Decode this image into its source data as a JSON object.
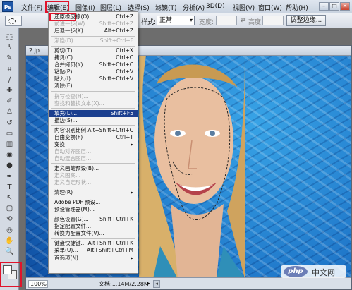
{
  "app": {
    "logo": "Ps"
  },
  "menubar": {
    "items": [
      "文件(F)",
      "编辑(E)",
      "图像(I)",
      "图层(L)",
      "选择(S)",
      "滤镜(T)",
      "分析(A)",
      "3D(D)",
      "视图(V)",
      "窗口(W)",
      "帮助(H)"
    ],
    "window_controls": [
      "–",
      "□",
      "✕"
    ]
  },
  "options_bar": {
    "style_label": "样式:",
    "style_value": "正常",
    "width_label": "宽度:",
    "height_label": "高度:",
    "swap_icon": "⇄",
    "refine_edge_label": "调整边缘..."
  },
  "toolbox": {
    "tools": [
      "marquee-icon",
      "lasso-icon",
      "quick-select-icon",
      "crop-icon",
      "eyedropper-icon",
      "healing-brush-icon",
      "brush-icon",
      "clone-stamp-icon",
      "history-brush-icon",
      "eraser-icon",
      "gradient-icon",
      "blur-icon",
      "dodge-icon",
      "pen-icon",
      "type-icon",
      "path-select-icon",
      "shape-icon",
      "3d-rotate-icon",
      "3d-orbit-icon",
      "hand-icon",
      "zoom-icon"
    ],
    "tool_glyphs": [
      "⬚",
      "ʖ",
      "✎",
      "⌗",
      "∕",
      "✚",
      "✐",
      "♙",
      "↺",
      "▭",
      "▥",
      "◉",
      "●",
      "✒",
      "T",
      "↖",
      "▢",
      "⟲",
      "◎",
      "✋",
      "🔍"
    ]
  },
  "document": {
    "title": "2.jp",
    "zoom": "100%",
    "doc_size": "文档:1.14M/2.28M",
    "status_arrow": "▸",
    "scroll_left": "◂"
  },
  "edit_menu": {
    "items": [
      {
        "label": "还原橡皮擦(O)",
        "shortcut": "Ctrl+Z",
        "disabled": false
      },
      {
        "label": "前进一步(W)",
        "shortcut": "Shift+Ctrl+Z",
        "disabled": true
      },
      {
        "label": "后退一步(K)",
        "shortcut": "Alt+Ctrl+Z",
        "disabled": false
      },
      {
        "sep": true
      },
      {
        "label": "渐隐(D)...",
        "shortcut": "Shift+Ctrl+F",
        "disabled": true
      },
      {
        "sep": true
      },
      {
        "label": "剪切(T)",
        "shortcut": "Ctrl+X",
        "disabled": false
      },
      {
        "label": "拷贝(C)",
        "shortcut": "Ctrl+C",
        "disabled": false
      },
      {
        "label": "合并拷贝(Y)",
        "shortcut": "Shift+Ctrl+C",
        "disabled": false
      },
      {
        "label": "粘贴(P)",
        "shortcut": "Ctrl+V",
        "disabled": false
      },
      {
        "label": "贴入(I)",
        "shortcut": "Shift+Ctrl+V",
        "disabled": false
      },
      {
        "label": "清除(E)",
        "shortcut": "",
        "disabled": false
      },
      {
        "sep": true
      },
      {
        "label": "拼写检查(H)...",
        "shortcut": "",
        "disabled": true
      },
      {
        "label": "查找和替换文本(X)...",
        "shortcut": "",
        "disabled": true
      },
      {
        "sep": true
      },
      {
        "label": "填充(L)...",
        "shortcut": "Shift+F5",
        "disabled": false,
        "highlighted": true
      },
      {
        "label": "描边(S)...",
        "shortcut": "",
        "disabled": false
      },
      {
        "sep": true
      },
      {
        "label": "内容识别比例",
        "shortcut": "Alt+Shift+Ctrl+C",
        "disabled": false
      },
      {
        "label": "自由变换(F)",
        "shortcut": "Ctrl+T",
        "disabled": false
      },
      {
        "label": "变换",
        "shortcut": "▸",
        "disabled": false
      },
      {
        "label": "自动对齐图层...",
        "shortcut": "",
        "disabled": true
      },
      {
        "label": "自动混合图层...",
        "shortcut": "",
        "disabled": true
      },
      {
        "sep": true
      },
      {
        "label": "定义画笔预设(B)...",
        "shortcut": "",
        "disabled": false
      },
      {
        "label": "定义图案...",
        "shortcut": "",
        "disabled": true
      },
      {
        "label": "定义自定形状...",
        "shortcut": "",
        "disabled": true
      },
      {
        "sep": true
      },
      {
        "label": "清理(R)",
        "shortcut": "▸",
        "disabled": false
      },
      {
        "sep": true
      },
      {
        "label": "Adobe PDF 预设...",
        "shortcut": "",
        "disabled": false
      },
      {
        "label": "预设管理器(M)...",
        "shortcut": "",
        "disabled": false
      },
      {
        "sep": true
      },
      {
        "label": "颜色设置(G)...",
        "shortcut": "Shift+Ctrl+K",
        "disabled": false
      },
      {
        "label": "指定配置文件...",
        "shortcut": "",
        "disabled": false
      },
      {
        "label": "转换为配置文件(V)...",
        "shortcut": "",
        "disabled": false
      },
      {
        "sep": true
      },
      {
        "label": "键盘快捷键...",
        "shortcut": "Alt+Shift+Ctrl+K",
        "disabled": false
      },
      {
        "label": "菜单(U)...",
        "shortcut": "Alt+Shift+Ctrl+M",
        "disabled": false
      },
      {
        "label": "首选项(N)",
        "shortcut": "▸",
        "disabled": false
      }
    ]
  },
  "watermark": {
    "logo": "php",
    "text": "中文网"
  },
  "colors": {
    "highlight": "#1b3f8f",
    "callout": "#e0142b"
  }
}
